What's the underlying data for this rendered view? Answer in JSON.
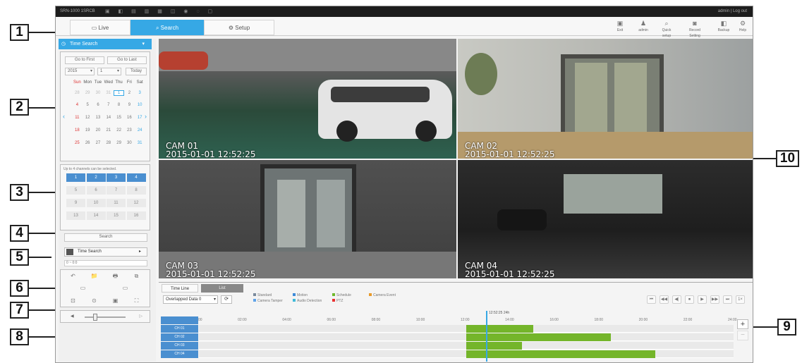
{
  "callouts": [
    "1",
    "2",
    "3",
    "4",
    "5",
    "6",
    "7",
    "8",
    "9",
    "10"
  ],
  "window": {
    "title": "SRN-1000 1SRCB",
    "user_info": "admin | Log out",
    "topbar_icons": "▣ ◧ ▤ ▥ ▦ ◫ ◉ ◌ ▢"
  },
  "nav_tabs": [
    {
      "icon": "monitor-icon",
      "label": "Live",
      "active": false
    },
    {
      "icon": "magnifier-icon",
      "label": "Search",
      "active": true
    },
    {
      "icon": "gear-icon",
      "label": "Setup",
      "active": false
    }
  ],
  "toolbar": [
    {
      "icon": "alarm-icon",
      "label": "Exit"
    },
    {
      "icon": "user-icon",
      "label": "admin"
    },
    {
      "icon": "search-icon",
      "label": "Quick setup"
    },
    {
      "icon": "camera-icon",
      "label": "Record Setting"
    },
    {
      "icon": "speaker-icon",
      "label": "Backup"
    },
    {
      "icon": "help-icon",
      "label": "Help"
    }
  ],
  "left_panel": {
    "time_search_title": "Time Search",
    "go_first": "Go to First",
    "go_last": "Go to Last",
    "year": "2015",
    "month": "1",
    "today": "Today",
    "weekdays": [
      "Sun",
      "Mon",
      "Tue",
      "Wed",
      "Thu",
      "Fri",
      "Sat"
    ],
    "calendar_rows": [
      [
        "28",
        "29",
        "30",
        "31",
        "1",
        "2",
        "3"
      ],
      [
        "4",
        "5",
        "6",
        "7",
        "8",
        "9",
        "10"
      ],
      [
        "11",
        "12",
        "13",
        "14",
        "15",
        "16",
        "17"
      ],
      [
        "18",
        "19",
        "20",
        "21",
        "22",
        "23",
        "24"
      ],
      [
        "25",
        "26",
        "27",
        "28",
        "29",
        "30",
        "31"
      ]
    ],
    "selected_day": "1",
    "channel_hint": "Up to 4 channels can be selected.",
    "channels": [
      "1",
      "2",
      "3",
      "4",
      "5",
      "6",
      "7",
      "8",
      "9",
      "10",
      "11",
      "12",
      "13",
      "14",
      "15",
      "16"
    ],
    "selected_channels": [
      "1",
      "2",
      "3",
      "4"
    ],
    "search_button": "Search",
    "time_search_dropdown": "Time Search",
    "time_value": "0 ~ 0:0",
    "controls_row1": [
      "↶",
      "📁",
      "🖶",
      "⧉"
    ],
    "controls_row2": [
      "▭",
      "▭"
    ],
    "controls_row3": [
      "⊡",
      "⊙",
      "▣",
      "⛶"
    ],
    "volume_icon": "◀",
    "volume_value": 25
  },
  "cameras": [
    {
      "name": "CAM 01",
      "timestamp": "2015-01-01 12:52:25"
    },
    {
      "name": "CAM 02",
      "timestamp": "2015-01-01 12:52:25"
    },
    {
      "name": "CAM 03",
      "timestamp": "2015-01-01 12:52:25"
    },
    {
      "name": "CAM 04",
      "timestamp": "2015-01-01 12:52:25"
    }
  ],
  "timeline": {
    "tabs": [
      "Time Line",
      "List"
    ],
    "overlapped": "Overlapped Data 0",
    "legend": [
      {
        "label": "Standard",
        "color": "#7a8a9c"
      },
      {
        "label": "Motion",
        "color": "#3d8bd8"
      },
      {
        "label": "Schedule",
        "color": "#6fb82b"
      },
      {
        "label": "Camera Event",
        "color": "#e89a2a"
      },
      {
        "label": "Camera Tamper",
        "color": "#5fa3e8"
      },
      {
        "label": "Audio Detection",
        "color": "#3fb9d8"
      },
      {
        "label": "PTZ",
        "color": "#e83030"
      }
    ],
    "current_time": "12:52:25",
    "zoom": "24h",
    "hours": [
      "00:00",
      "02:00",
      "04:00",
      "06:00",
      "08:00",
      "10:00",
      "12:00",
      "14:00",
      "16:00",
      "18:00",
      "20:00",
      "22:00",
      "24:00"
    ],
    "tracks": [
      "CH 01",
      "CH 02",
      "CH 03",
      "CH 04"
    ],
    "track_values": {
      "ch01_end": 15.0,
      "ch02_end": 18.5,
      "ch03_end": 14.5,
      "ch04_end": 20.5,
      "start": 12.0
    },
    "playback_buttons": [
      "⏮",
      "◀◀",
      "◀|",
      "⏹",
      "▶",
      "▶▶",
      "⏭",
      "1×"
    ],
    "zoom_plus": "+",
    "zoom_minus": "−"
  }
}
